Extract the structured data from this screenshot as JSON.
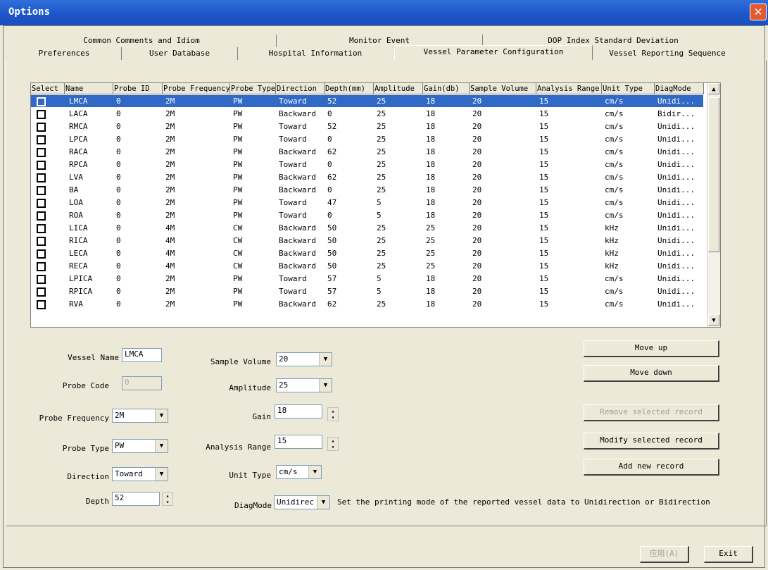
{
  "window": {
    "title": "Options",
    "close": "✕"
  },
  "tabs_row1": [
    "Common Comments and Idiom",
    "Monitor Event",
    "DOP Index Standard Deviation"
  ],
  "tabs_row2": [
    "Preferences",
    "User Database",
    "Hospital Information",
    "Vessel Parameter Configuration",
    "Vessel Reporting Sequence"
  ],
  "active_tab": "Vessel Parameter Configuration",
  "grid": {
    "columns": [
      "Select",
      "Name",
      "Probe ID",
      "Probe Frequency",
      "Probe Type",
      "Direction",
      "Depth(mm)",
      "Amplitude",
      "Gain(db)",
      "Sample Volume",
      "Analysis Range",
      "Unit Type",
      "DiagMode"
    ],
    "rows": [
      [
        "LMCA",
        "0",
        "2M",
        "PW",
        "Toward",
        "52",
        "25",
        "18",
        "20",
        "15",
        "cm/s",
        "Unidi..."
      ],
      [
        "LACA",
        "0",
        "2M",
        "PW",
        "Backward",
        "0",
        "25",
        "18",
        "20",
        "15",
        "cm/s",
        "Bidir..."
      ],
      [
        "RMCA",
        "0",
        "2M",
        "PW",
        "Toward",
        "52",
        "25",
        "18",
        "20",
        "15",
        "cm/s",
        "Unidi..."
      ],
      [
        "LPCA",
        "0",
        "2M",
        "PW",
        "Toward",
        "0",
        "25",
        "18",
        "20",
        "15",
        "cm/s",
        "Unidi..."
      ],
      [
        "RACA",
        "0",
        "2M",
        "PW",
        "Backward",
        "62",
        "25",
        "18",
        "20",
        "15",
        "cm/s",
        "Unidi..."
      ],
      [
        "RPCA",
        "0",
        "2M",
        "PW",
        "Toward",
        "0",
        "25",
        "18",
        "20",
        "15",
        "cm/s",
        "Unidi..."
      ],
      [
        "LVA",
        "0",
        "2M",
        "PW",
        "Backward",
        "62",
        "25",
        "18",
        "20",
        "15",
        "cm/s",
        "Unidi..."
      ],
      [
        "BA",
        "0",
        "2M",
        "PW",
        "Backward",
        "0",
        "25",
        "18",
        "20",
        "15",
        "cm/s",
        "Unidi..."
      ],
      [
        "LOA",
        "0",
        "2M",
        "PW",
        "Toward",
        "47",
        "5",
        "18",
        "20",
        "15",
        "cm/s",
        "Unidi..."
      ],
      [
        "ROA",
        "0",
        "2M",
        "PW",
        "Toward",
        "0",
        "5",
        "18",
        "20",
        "15",
        "cm/s",
        "Unidi..."
      ],
      [
        "LICA",
        "0",
        "4M",
        "CW",
        "Backward",
        "50",
        "25",
        "25",
        "20",
        "15",
        "kHz",
        "Unidi..."
      ],
      [
        "RICA",
        "0",
        "4M",
        "CW",
        "Backward",
        "50",
        "25",
        "25",
        "20",
        "15",
        "kHz",
        "Unidi..."
      ],
      [
        "LECA",
        "0",
        "4M",
        "CW",
        "Backward",
        "50",
        "25",
        "25",
        "20",
        "15",
        "kHz",
        "Unidi..."
      ],
      [
        "RECA",
        "0",
        "4M",
        "CW",
        "Backward",
        "50",
        "25",
        "25",
        "20",
        "15",
        "kHz",
        "Unidi..."
      ],
      [
        "LPICA",
        "0",
        "2M",
        "PW",
        "Toward",
        "57",
        "5",
        "18",
        "20",
        "15",
        "cm/s",
        "Unidi..."
      ],
      [
        "RPICA",
        "0",
        "2M",
        "PW",
        "Toward",
        "57",
        "5",
        "18",
        "20",
        "15",
        "cm/s",
        "Unidi..."
      ],
      [
        "RVA",
        "0",
        "2M",
        "PW",
        "Backward",
        "62",
        "25",
        "18",
        "20",
        "15",
        "cm/s",
        "Unidi..."
      ]
    ],
    "selected_index": 0
  },
  "form": {
    "vessel_name_label": "Vessel Name",
    "vessel_name": "LMCA",
    "probe_code_label": "Probe Code",
    "probe_code": "0",
    "probe_frequency_label": "Probe Frequency",
    "probe_frequency": "2M",
    "probe_type_label": "Probe Type",
    "probe_type": "PW",
    "direction_label": "Direction",
    "direction": "Toward",
    "depth_label": "Depth",
    "depth": "52",
    "sample_volume_label": "Sample Volume",
    "sample_volume": "20",
    "amplitude_label": "Amplitude",
    "amplitude": "25",
    "gain_label": "Gain",
    "gain": "18",
    "analysis_range_label": "Analysis Range",
    "analysis_range": "15",
    "unit_type_label": "Unit Type",
    "unit_type": "cm/s",
    "diagmode_label": "DiagMode",
    "diagmode": "Unidirec",
    "diagmode_hint": "Set the printing mode of the reported vessel data to Unidirection or Bidirection"
  },
  "buttons": {
    "move_up": "Move up",
    "move_down": "Move down",
    "remove": "Remove selected record",
    "modify": "Modify selected record",
    "add": "Add new record",
    "apply": "应用(A)",
    "exit": "Exit"
  },
  "colors": {
    "selection": "#3169c6",
    "titlebar": "#1d56c9",
    "face": "#ece9d8"
  }
}
